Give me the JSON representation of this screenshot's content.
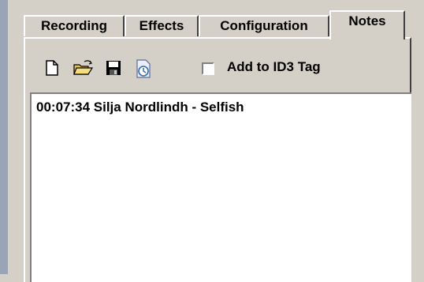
{
  "tabs": [
    {
      "label": "Recording"
    },
    {
      "label": "Effects"
    },
    {
      "label": "Configuration"
    },
    {
      "label": "Notes"
    }
  ],
  "active_tab": "Notes",
  "toolbar": {
    "icons": [
      "new-file-icon",
      "open-folder-icon",
      "save-disk-icon",
      "timestamp-icon"
    ],
    "add_to_id3_label": "Add to ID3 Tag",
    "add_to_id3_checked": false
  },
  "notes": {
    "lines": [
      "00:07:34 Silja Nordlindh - Selfish"
    ]
  },
  "colors": {
    "face": "#d4d0c8",
    "strip": "#9aa4b8"
  }
}
